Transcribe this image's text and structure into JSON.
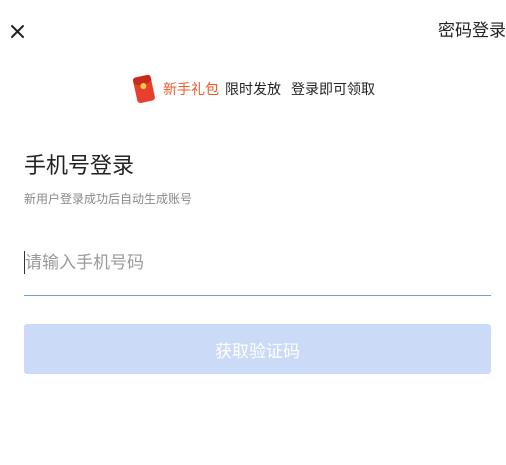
{
  "header": {
    "close_icon": "close-icon",
    "password_login_label": "密码登录"
  },
  "promo": {
    "icon": "red-envelope-icon",
    "gift_label": "新手礼包",
    "limited_label": "限时发放",
    "instant_label": "登录即可领取",
    "accent_color": "#f0592a"
  },
  "login": {
    "title": "手机号登录",
    "subtitle": "新用户登录成功后自动生成账号",
    "phone_placeholder": "请输入手机号码",
    "phone_value": "",
    "get_code_label": "获取验证码",
    "button_color": "#cbdaf6"
  }
}
